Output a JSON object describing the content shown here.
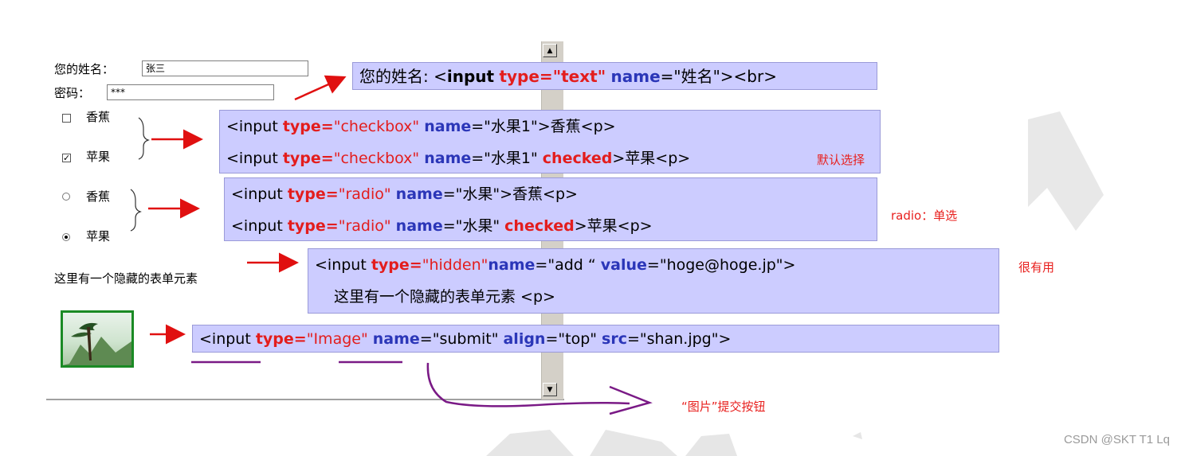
{
  "form": {
    "name_label": "您的姓名：",
    "name_value": "张三",
    "password_label": "密码：",
    "password_value": "***",
    "fruit1_label": "香蕉",
    "fruit2_label": "苹果",
    "fruit1_checked": false,
    "fruit2_checked": true,
    "radio1_label": "香蕉",
    "radio2_label": "苹果",
    "hidden_label": "这里有一个隐藏的表单元素"
  },
  "code_text": {
    "prefix_name": "您的姓名: ",
    "lt": "<",
    "input_word": "input",
    "type_kw": "type=",
    "text_val": "\"text\"",
    "name_kw": "name",
    "name_val1": "=\"姓名\"><br>",
    "checkbox_val": "\"checkbox\"",
    "fruit1_attr": "=\"水果1\">香蕉<p>",
    "fruit1b_attr": "=\"水果1\" ",
    "checked_kw": "checked",
    "apple_tail": ">苹果<p>",
    "radio_val": "\"radio\"",
    "fruit_attr": "=\"水果\">香蕉<p>",
    "fruitb_attr": "=\"水果\" ",
    "hidden_val": "\"hidden\"",
    "hidden_name": "=\"add “ ",
    "value_kw": "value",
    "value_val": "=\"hoge@hoge.jp\">",
    "hidden_line2": "这里有一个隐藏的表单元素 <p>",
    "image_val": "\"Image\"",
    "submit_attr": "=\"submit\" ",
    "align_kw": "align",
    "align_val": "=\"top\" ",
    "src_kw": "src",
    "src_val": "=\"shan.jpg\">"
  },
  "notes": {
    "default_select": "默认选择",
    "radio_note": "radio：单选",
    "very_useful": "很有用",
    "image_note": "“图片”提交按钮"
  },
  "credit": "CSDN @SKT T1 Lq",
  "colors": {
    "code_bg": "#ccccff",
    "keyword_red": "#e31d1d",
    "name_blue": "#2b36b8",
    "arrow_red": "#e01010",
    "underline_purple": "#7a1a86"
  }
}
